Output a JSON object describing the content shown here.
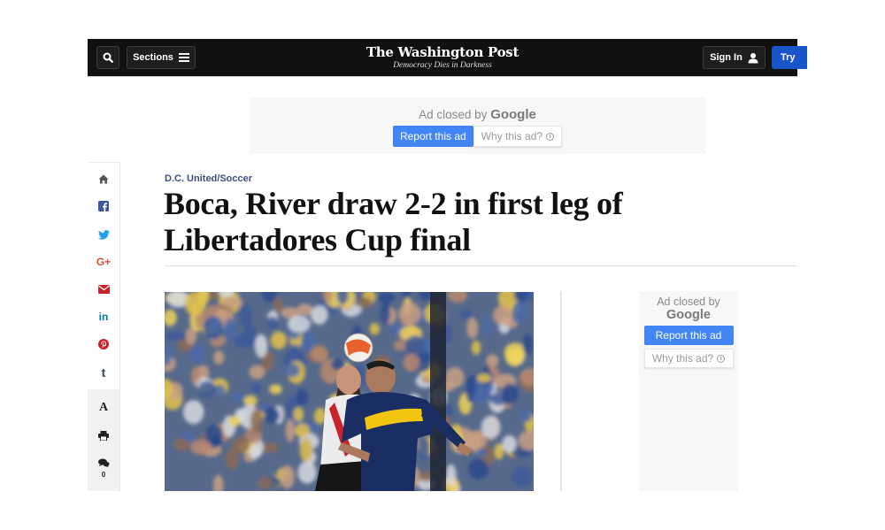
{
  "header": {
    "search_label": "Search",
    "sections_label": "Sections",
    "logo_title": "The Washington Post",
    "logo_tagline": "Democracy Dies in Darkness",
    "signin_label": "Sign In",
    "try_label": "Try",
    "colors": {
      "nav_bg": "#111111",
      "try_bg": "#1955c6"
    }
  },
  "top_ad": {
    "closed_prefix": "Ad closed by",
    "closed_brand": "Google",
    "report_label": "Report this ad",
    "why_label": "Why this ad?",
    "info_glyph": "i"
  },
  "share_rail": {
    "icons": [
      {
        "name": "home-icon",
        "color": "#555555"
      },
      {
        "name": "facebook-icon",
        "color": "#3b5998"
      },
      {
        "name": "twitter-icon",
        "color": "#1da1f2"
      },
      {
        "name": "google-plus-icon",
        "color": "#dd4b39"
      },
      {
        "name": "email-icon",
        "color": "#c8232c"
      },
      {
        "name": "linkedin-icon",
        "color": "#0077b5"
      },
      {
        "name": "pinterest-icon",
        "color": "#cb2027"
      },
      {
        "name": "tumblr-icon",
        "color": "#35465c"
      }
    ],
    "tools": [
      {
        "name": "font-size-icon",
        "glyph": "A"
      },
      {
        "name": "print-icon"
      },
      {
        "name": "comments-icon"
      }
    ],
    "linkedin_glyph": "in",
    "tumblr_glyph": "t",
    "gplus_glyph": "G+",
    "comment_count": "0"
  },
  "article": {
    "kicker": "D.C. United/Soccer",
    "headline": "Boca, River draw 2-2 in first leg of Libertadores Cup final",
    "image_alt": "Boca Juniors and River Plate players contest a header"
  },
  "right_ad": {
    "closed_prefix": "Ad closed by",
    "closed_brand": "Google",
    "report_label": "Report this ad",
    "why_label": "Why this ad?",
    "info_glyph": "i"
  }
}
